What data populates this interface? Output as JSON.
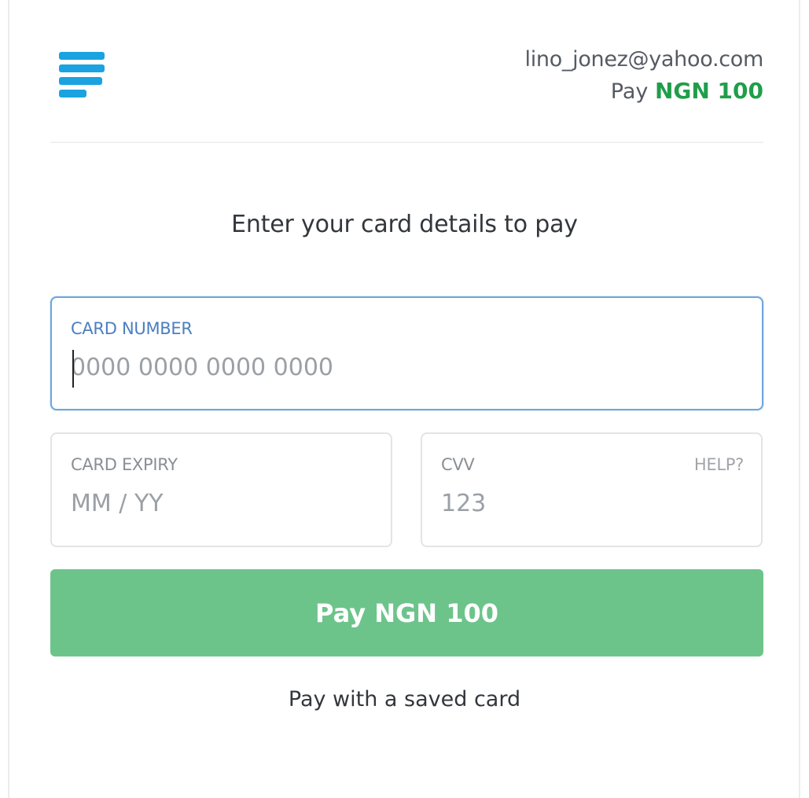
{
  "header": {
    "logo": "stacked-bars-logo",
    "email": "lino_jonez@yahoo.com",
    "pay_prefix": "Pay",
    "pay_amount": "NGN 100"
  },
  "form": {
    "heading": "Enter your card details to pay",
    "card_number": {
      "label": "CARD NUMBER",
      "placeholder": "0000 0000 0000 0000",
      "value": ""
    },
    "card_expiry": {
      "label": "CARD EXPIRY",
      "placeholder": "MM / YY",
      "value": ""
    },
    "cvv": {
      "label": "CVV",
      "placeholder": "123",
      "value": "",
      "help_label": "HELP?"
    },
    "pay_button_label": "Pay NGN 100",
    "saved_card_link": "Pay with a saved card"
  },
  "colors": {
    "accent_green": "#1f9e4a",
    "button_green": "#6dc48b",
    "logo_blue": "#1aa3e0",
    "focus_blue": "#6fa7dd"
  }
}
